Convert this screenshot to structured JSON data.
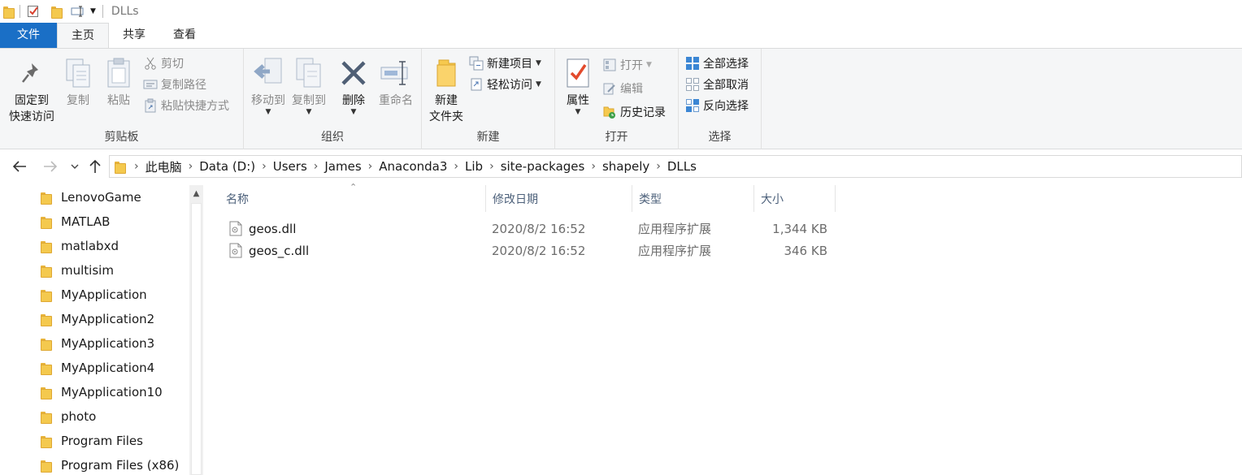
{
  "window": {
    "title": "DLLs"
  },
  "tabs": {
    "file": "文件",
    "home": "主页",
    "share": "共享",
    "view": "查看"
  },
  "ribbon": {
    "clipboard": {
      "label": "剪贴板",
      "pin_line1": "固定到",
      "pin_line2": "快速访问",
      "copy": "复制",
      "paste": "粘贴",
      "cut": "剪切",
      "copy_path": "复制路径",
      "paste_shortcut": "粘贴快捷方式"
    },
    "organize": {
      "label": "组织",
      "move_to": "移动到",
      "copy_to": "复制到",
      "delete": "删除",
      "rename": "重命名"
    },
    "new": {
      "label": "新建",
      "new_folder_line1": "新建",
      "new_folder_line2": "文件夹",
      "new_item": "新建项目",
      "easy_access": "轻松访问"
    },
    "open": {
      "label": "打开",
      "properties": "属性",
      "open": "打开",
      "edit": "编辑",
      "history": "历史记录"
    },
    "select": {
      "label": "选择",
      "select_all": "全部选择",
      "select_none": "全部取消",
      "invert": "反向选择"
    }
  },
  "breadcrumb": [
    "此电脑",
    "Data (D:)",
    "Users",
    "James",
    "Anaconda3",
    "Lib",
    "site-packages",
    "shapely",
    "DLLs"
  ],
  "nav_pane": {
    "items": [
      "LenovoGame",
      "MATLAB",
      "matlabxd",
      "multisim",
      "MyApplication",
      "MyApplication2",
      "MyApplication3",
      "MyApplication4",
      "MyApplication10",
      "photo",
      "Program Files",
      "Program Files (x86)"
    ]
  },
  "file_list": {
    "columns": {
      "name": "名称",
      "date": "修改日期",
      "type": "类型",
      "size": "大小"
    },
    "rows": [
      {
        "name": "geos.dll",
        "date": "2020/8/2 16:52",
        "type": "应用程序扩展",
        "size": "1,344 KB"
      },
      {
        "name": "geos_c.dll",
        "date": "2020/8/2 16:52",
        "type": "应用程序扩展",
        "size": "346 KB"
      }
    ]
  }
}
